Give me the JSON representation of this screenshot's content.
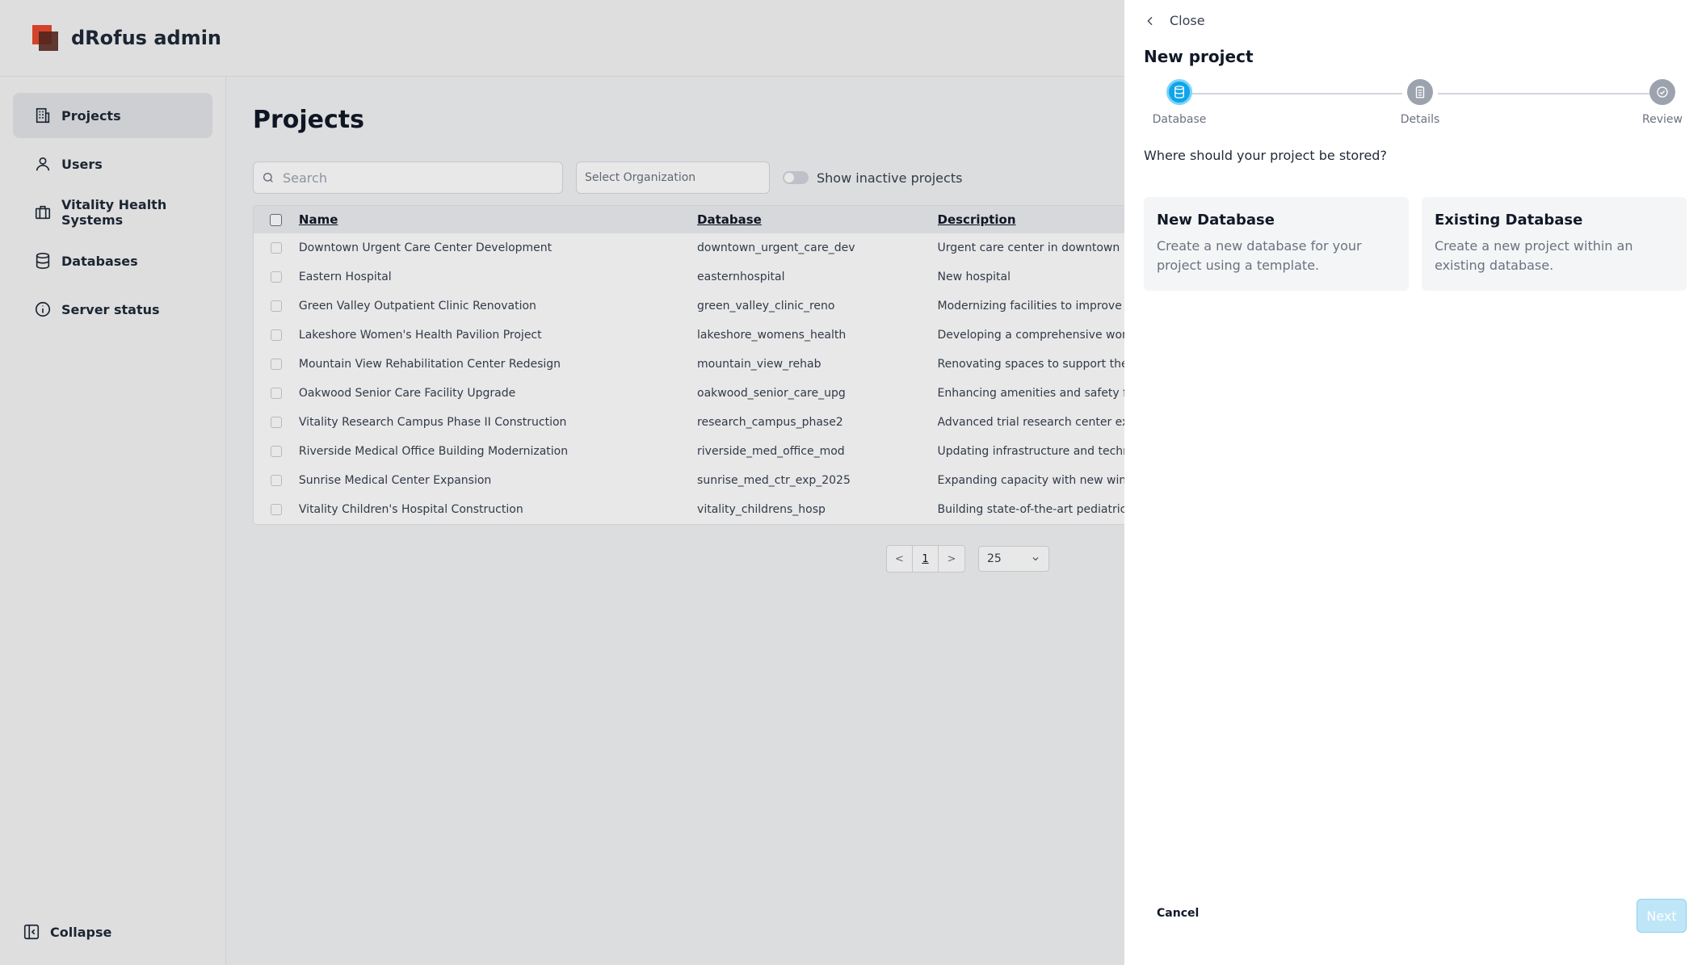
{
  "app": {
    "title": "dRofus admin"
  },
  "sidebar": {
    "items": [
      {
        "label": "Projects",
        "icon": "building-icon"
      },
      {
        "label": "Users",
        "icon": "user-icon"
      },
      {
        "label": "Vitality Health Systems",
        "icon": "briefcase-icon"
      },
      {
        "label": "Databases",
        "icon": "database-icon"
      },
      {
        "label": "Server status",
        "icon": "info-icon"
      }
    ],
    "collapse_label": "Collapse"
  },
  "main": {
    "title": "Projects",
    "search_placeholder": "Search",
    "org_placeholder": "Select Organization",
    "inactive_toggle_label": "Show inactive projects",
    "table": {
      "headers": [
        "Name",
        "Database",
        "Description"
      ],
      "rows": [
        [
          "Downtown Urgent Care Center Development",
          "downtown_urgent_care_dev",
          "Urgent care center in downtown"
        ],
        [
          "Eastern Hospital",
          "easternhospital",
          "New hospital"
        ],
        [
          "Green Valley Outpatient Clinic Renovation",
          "green_valley_clinic_reno",
          "Modernizing facilities to improve pa"
        ],
        [
          "Lakeshore Women's Health Pavilion Project",
          "lakeshore_womens_health",
          "Developing a comprehensive wome"
        ],
        [
          "Mountain View Rehabilitation Center Redesign",
          "mountain_view_rehab",
          "Renovating spaces to support the l"
        ],
        [
          "Oakwood Senior Care Facility Upgrade",
          "oakwood_senior_care_upg",
          "Enhancing amenities and safety fea"
        ],
        [
          "Vitality Research Campus Phase II Construction",
          "research_campus_phase2",
          "Advanced trial research center exp"
        ],
        [
          "Riverside Medical Office Building Modernization",
          "riverside_med_office_mod",
          "Updating infrastructure and techno"
        ],
        [
          "Sunrise Medical Center Expansion",
          "sunrise_med_ctr_exp_2025",
          "Expanding capacity with new wing"
        ],
        [
          "Vitality Children's Hospital Construction",
          "vitality_childrens_hosp",
          "Building state-of-the-art pediatric"
        ]
      ]
    },
    "pagination": {
      "prev": "<",
      "current_page": "1",
      "next": ">",
      "per_page": "25"
    }
  },
  "drawer": {
    "close_label": "Close",
    "title": "New project",
    "steps": [
      {
        "label": "Database",
        "icon": "database-icon",
        "active": true
      },
      {
        "label": "Details",
        "icon": "clipboard-icon",
        "active": false
      },
      {
        "label": "Review",
        "icon": "check-circle-icon",
        "active": false
      }
    ],
    "question": "Where should your project be stored?",
    "options": [
      {
        "title": "New Database",
        "description": "Create a new database for your project using a template."
      },
      {
        "title": "Existing Database",
        "description": "Create a new project within an existing database."
      }
    ],
    "cancel_label": "Cancel",
    "next_label": "Next"
  },
  "colors": {
    "accent": "#0ea5e9",
    "next_disabled": "#bfe6f7",
    "logo_red": "#e8492f"
  }
}
